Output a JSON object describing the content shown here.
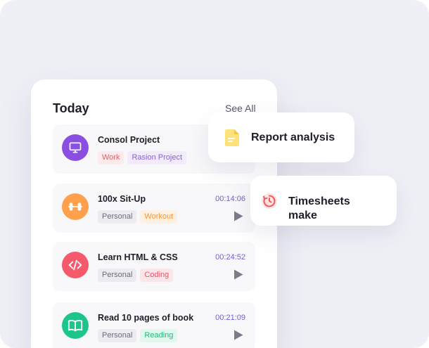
{
  "today": {
    "title": "Today",
    "see_all": "See All",
    "tasks": [
      {
        "name": "Consol Project",
        "time": "",
        "icon": "monitor-icon",
        "icon_color": "#8a4fe0",
        "tags": [
          {
            "label": "Work",
            "color": "#e2626a",
            "bg": "#fdeaec"
          },
          {
            "label": "Rasion Project",
            "color": "#8a5fd8",
            "bg": "#f1ebfc"
          }
        ]
      },
      {
        "name": "100x Sit-Up",
        "time": "00:14:06",
        "icon": "dumbbell-icon",
        "icon_color": "#ffa04d",
        "tags": [
          {
            "label": "Personal",
            "color": "#6a6d7c",
            "bg": "#ececf0"
          },
          {
            "label": "Workout",
            "color": "#f2963d",
            "bg": "#fff0e0"
          }
        ]
      },
      {
        "name": "Learn HTML & CSS",
        "time": "00:24:52",
        "icon": "code-icon",
        "icon_color": "#f4596c",
        "tags": [
          {
            "label": "Personal",
            "color": "#6a6d7c",
            "bg": "#ececf0"
          },
          {
            "label": "Coding",
            "color": "#ec5766",
            "bg": "#fde6e9"
          }
        ]
      },
      {
        "name": "Read 10 pages of book",
        "time": "00:21:09",
        "icon": "book-icon",
        "icon_color": "#1ec58a",
        "tags": [
          {
            "label": "Personal",
            "color": "#6a6d7c",
            "bg": "#ececf0"
          },
          {
            "label": "Reading",
            "color": "#20b97f",
            "bg": "#e2f7ee"
          }
        ]
      }
    ]
  },
  "floating": [
    {
      "label": "Report analysis",
      "icon": "document-icon",
      "icon_color": "#fcd55a"
    },
    {
      "label": "Timesheets make",
      "icon": "clock-icon",
      "icon_color": "#ef5a5a"
    }
  ],
  "colors": {
    "time_accent": "#6b5fe0",
    "play": "#7a7d88"
  }
}
